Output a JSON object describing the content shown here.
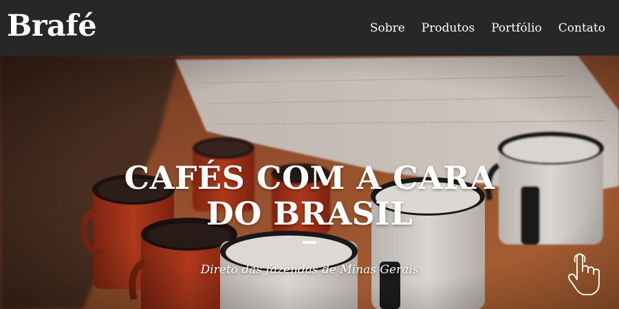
{
  "header": {
    "logo": "Brafé",
    "nav": [
      {
        "label": "Sobre"
      },
      {
        "label": "Produtos"
      },
      {
        "label": "Portfólio"
      },
      {
        "label": "Contato"
      }
    ]
  },
  "hero": {
    "title": "CAFÉS COM A CARA DO BRASIL",
    "subtitle": "Direto das fazendas de Minas Gerais",
    "background": "enamel coffee cups on wooden table",
    "scroll_icon": "pointing-hand-icon"
  },
  "colors": {
    "header_bg": "#272727",
    "text": "#ffffff"
  }
}
